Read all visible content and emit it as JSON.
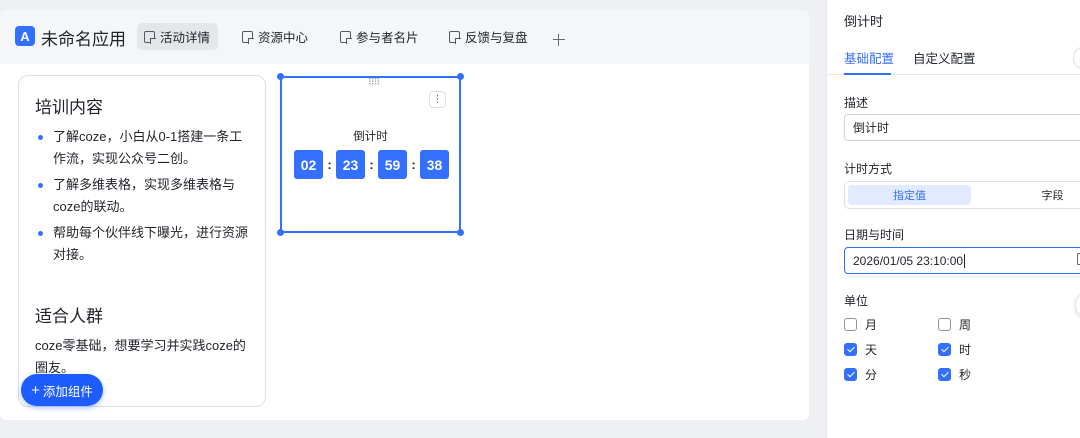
{
  "app": {
    "logo_glyph": "A",
    "name": "未命名应用"
  },
  "tabs": [
    {
      "label": "活动详情",
      "active": true
    },
    {
      "label": "资源中心",
      "active": false
    },
    {
      "label": "参与者名片",
      "active": false
    },
    {
      "label": "反馈与复盘",
      "active": false
    }
  ],
  "card": {
    "section1_title": "培训内容",
    "items": [
      "了解coze，小白从0-1搭建一条工作流，实现公众号二创。",
      "了解多维表格，实现多维表格与coze的联动。",
      "帮助每个伙伴线下曝光，进行资源对接。"
    ],
    "section2_title": "适合人群",
    "section2_text": "coze零基础，想要学习并实践coze的圈友。"
  },
  "add_widget_label": "添加组件",
  "countdown": {
    "title": "倒计时",
    "values": [
      "02",
      "23",
      "59",
      "38"
    ],
    "separator": ":"
  },
  "panel": {
    "title": "倒计时",
    "tabs": [
      "基础配置",
      "自定义配置"
    ],
    "desc_label": "描述",
    "desc_value": "倒计时",
    "mode_label": "计时方式",
    "mode_options": [
      "指定值",
      "字段"
    ],
    "mode_selected": "指定值",
    "datetime_label": "日期与时间",
    "datetime_value": "2026/01/05 23:10:00",
    "unit_label": "单位",
    "units": [
      {
        "label": "月",
        "checked": false
      },
      {
        "label": "周",
        "checked": false
      },
      {
        "label": "天",
        "checked": true
      },
      {
        "label": "时",
        "checked": true
      },
      {
        "label": "分",
        "checked": true
      },
      {
        "label": "秒",
        "checked": true
      }
    ]
  },
  "colors": {
    "accent": "#3370ff",
    "button": "#1d5cff"
  }
}
